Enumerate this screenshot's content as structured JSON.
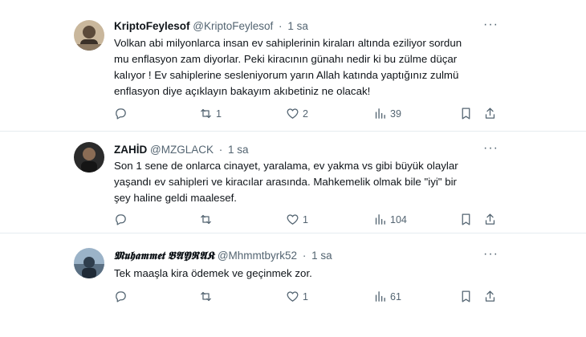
{
  "tweets": [
    {
      "name": "KriptoFeylesof",
      "handle": "@KriptoFeylesof",
      "separator": "·",
      "time": "1 sa",
      "more": "···",
      "lines": [
        "Volkan abi milyonlarca insan ev sahiplerinin kiraları altında eziliyor sordun",
        "mu enflasyon zam diyorlar. Peki kiracının günahı nedir ki bu zülme düçar",
        "kalıyor ! Ev sahiplerine sesleniyorum yarın Allah katında yaptığınız zulmü",
        "enflasyon diye açıklayın bakayım akıbetiniz ne olacak!"
      ],
      "replies": "",
      "retweets": "1",
      "likes": "2",
      "views": "39",
      "icons": {
        "reply": "reply-icon",
        "retweet": "retweet-icon",
        "like": "heart-icon",
        "views": "views-icon",
        "bookmark": "bookmark-icon",
        "share": "share-icon"
      }
    },
    {
      "name": "ZAHİD",
      "handle": "@MZGLACK",
      "separator": "·",
      "time": "1 sa",
      "more": "···",
      "lines": [
        "Son 1 sene de onlarca cinayet, yaralama, ev yakma vs gibi büyük olaylar",
        "yaşandı ev sahipleri ve kiracılar arasında. Mahkemelik olmak bile \"iyi\" bir",
        "şey haline geldi maalesef."
      ],
      "replies": "",
      "retweets": "",
      "likes": "1",
      "views": "104"
    },
    {
      "name_fancy": "𝕸𝖚𝖍𝖆𝖒𝖒𝖊𝖙",
      "name_caps": "𝕭𝕬𝖄𝕽𝕬𝕶",
      "handle": "@Mhmmtbyrk52",
      "separator": "·",
      "time": "1 sa",
      "more": "···",
      "lines": [
        "Tek maaşla kira ödemek ve geçinmek zor."
      ],
      "replies": "",
      "retweets": "",
      "likes": "1",
      "views": "61"
    }
  ],
  "colors": {
    "text": "#0f1419",
    "muted": "#536471",
    "divider": "#e6ecf0"
  }
}
